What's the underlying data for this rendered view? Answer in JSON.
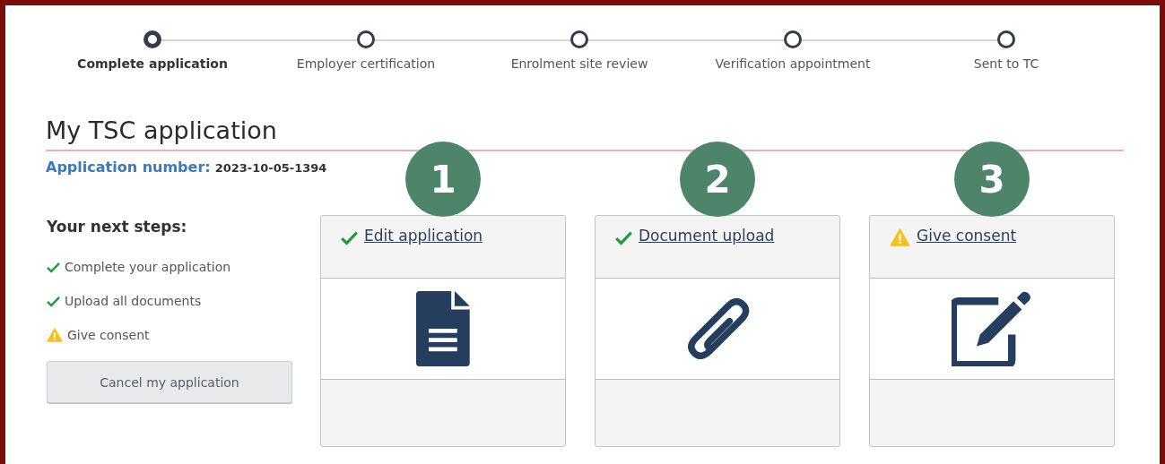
{
  "stepper": [
    {
      "label": "Complete application",
      "selected": true
    },
    {
      "label": "Employer certification",
      "selected": false
    },
    {
      "label": "Enrolment site review",
      "selected": false
    },
    {
      "label": "Verification appointment",
      "selected": false
    },
    {
      "label": "Sent to TC",
      "selected": false
    }
  ],
  "title": "My TSC application",
  "application_number": {
    "label": "Application number:",
    "value": "2023-10-05-1394"
  },
  "next_steps": {
    "heading": "Your next steps:",
    "items": [
      {
        "label": "Complete your application",
        "complete": true
      },
      {
        "label": "Upload all documents",
        "complete": true
      },
      {
        "label": "Give consent",
        "complete": false
      }
    ]
  },
  "cancel_button": "Cancel my application",
  "cards": [
    {
      "number": "1",
      "link": "Edit application",
      "complete": true,
      "kind": "document"
    },
    {
      "number": "2",
      "link": "Document upload",
      "complete": true,
      "kind": "paperclip"
    },
    {
      "number": "3",
      "link": "Give consent",
      "complete": false,
      "kind": "edit"
    }
  ]
}
